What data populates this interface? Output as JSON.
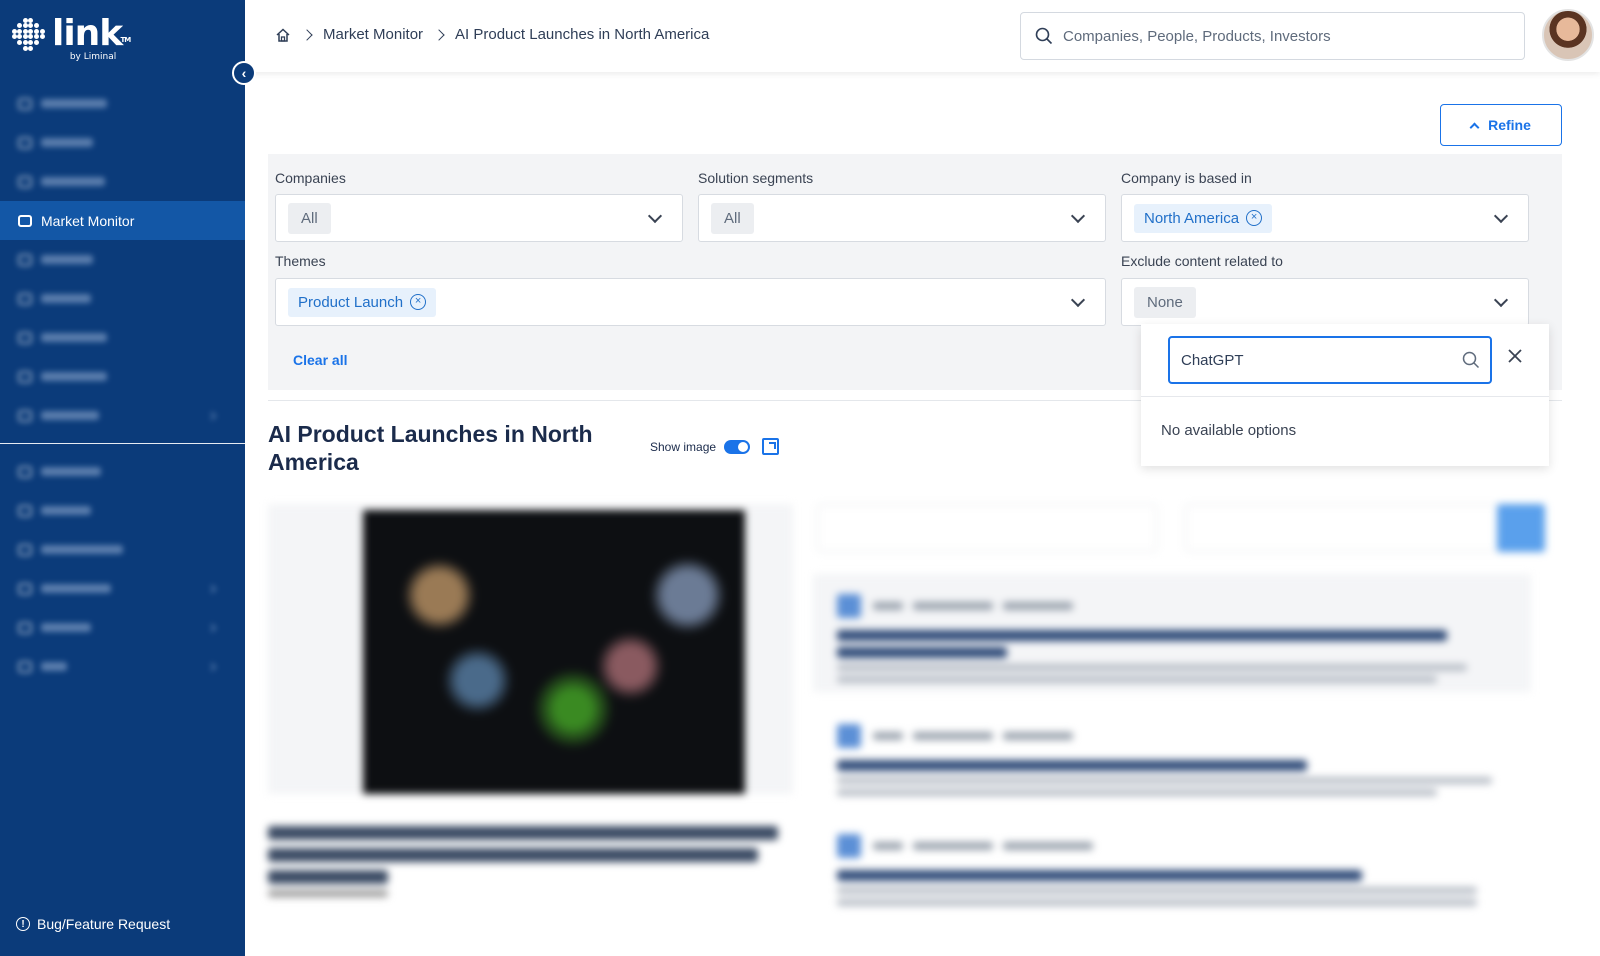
{
  "app": {
    "logo_text": "link",
    "logo_sub": "by Liminal",
    "logo_tm": "TM"
  },
  "sidebar": {
    "active_item": "Market Monitor",
    "bug_label": "Bug/Feature Request"
  },
  "header": {
    "breadcrumbs": [
      "Market Monitor",
      "AI Product Launches in North America"
    ],
    "search_placeholder": "Companies, People, Products, Investors"
  },
  "filters": {
    "refine_label": "Refine",
    "companies_label": "Companies",
    "companies_value": "All",
    "segments_label": "Solution segments",
    "segments_value": "All",
    "based_in_label": "Company is based in",
    "based_in_value": "North America",
    "themes_label": "Themes",
    "themes_value": "Product Launch",
    "exclude_label": "Exclude content related to",
    "exclude_value": "None",
    "clear_all": "Clear all"
  },
  "dropdown": {
    "search_value": "ChatGPT",
    "empty_message": "No available options"
  },
  "results": {
    "title": "AI Product Launches in North America",
    "show_image_label": "Show image",
    "show_image_on": true
  },
  "colors": {
    "sidebar": "#0b3b7a",
    "accent": "#1a73e8",
    "chip_bg": "#e7f1fc"
  }
}
